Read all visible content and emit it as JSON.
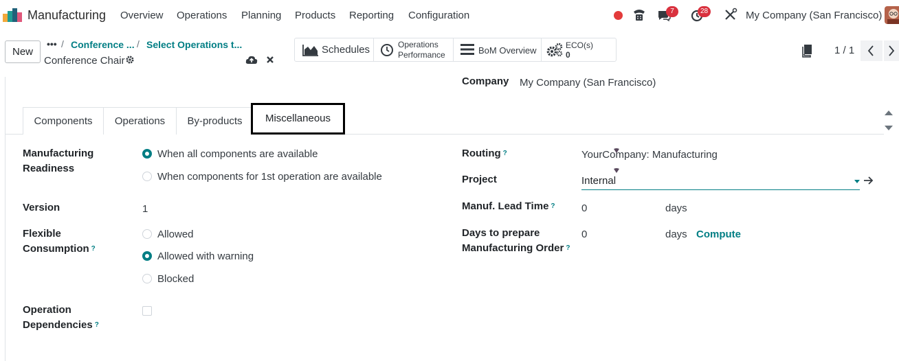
{
  "navbar": {
    "app_name": "Manufacturing",
    "menu": [
      "Overview",
      "Operations",
      "Planning",
      "Products",
      "Reporting",
      "Configuration"
    ],
    "messages_badge": "7",
    "activities_badge": "28",
    "company": "My Company (San Francisco)",
    "accent_color": "#017e84",
    "recording_color": "#e33b3b"
  },
  "control_panel": {
    "new_label": "New",
    "breadcrumb_dots": "•••",
    "breadcrumbs": [
      "Conference ...",
      "Select Operations t..."
    ],
    "record_name": "Conference Chair",
    "pager": "1 / 1"
  },
  "smart_buttons": {
    "schedules": "Schedules",
    "operations_performance_line1": "Operations",
    "operations_performance_line2": "Performance",
    "bom_overview": "BoM Overview",
    "eco_label": "ECO(s)",
    "eco_count": "0"
  },
  "form": {
    "company_label": "Company",
    "company_value": "My Company (San Francisco)",
    "tabs": [
      "Components",
      "Operations",
      "By-products",
      "Miscellaneous"
    ],
    "active_tab": "Miscellaneous",
    "readiness_label_line1": "Manufacturing",
    "readiness_label_line2": "Readiness",
    "readiness_options": [
      "When all components are available",
      "When components for 1st operation are available"
    ],
    "readiness_selected": "When all components are available",
    "version_label": "Version",
    "version_value": "1",
    "flexible_label_line1": "Flexible",
    "flexible_label_line2": "Consumption",
    "flexible_options": [
      "Allowed",
      "Allowed with warning",
      "Blocked"
    ],
    "flexible_selected": "Allowed with warning",
    "dependencies_label_line1": "Operation",
    "dependencies_label_line2": "Dependencies",
    "dependencies_checked": false,
    "help_mark": "?",
    "routing_label": "Routing",
    "routing_value": "YourCompany: Manufacturing",
    "project_label": "Project",
    "project_value": "Internal",
    "lead_time_label": "Manuf. Lead Time",
    "lead_time_value": "0",
    "lead_time_unit": "days",
    "prepare_label_line1": "Days to prepare",
    "prepare_label_line2": "Manufacturing Order",
    "prepare_value": "0",
    "prepare_unit": "days",
    "compute_label": "Compute"
  }
}
